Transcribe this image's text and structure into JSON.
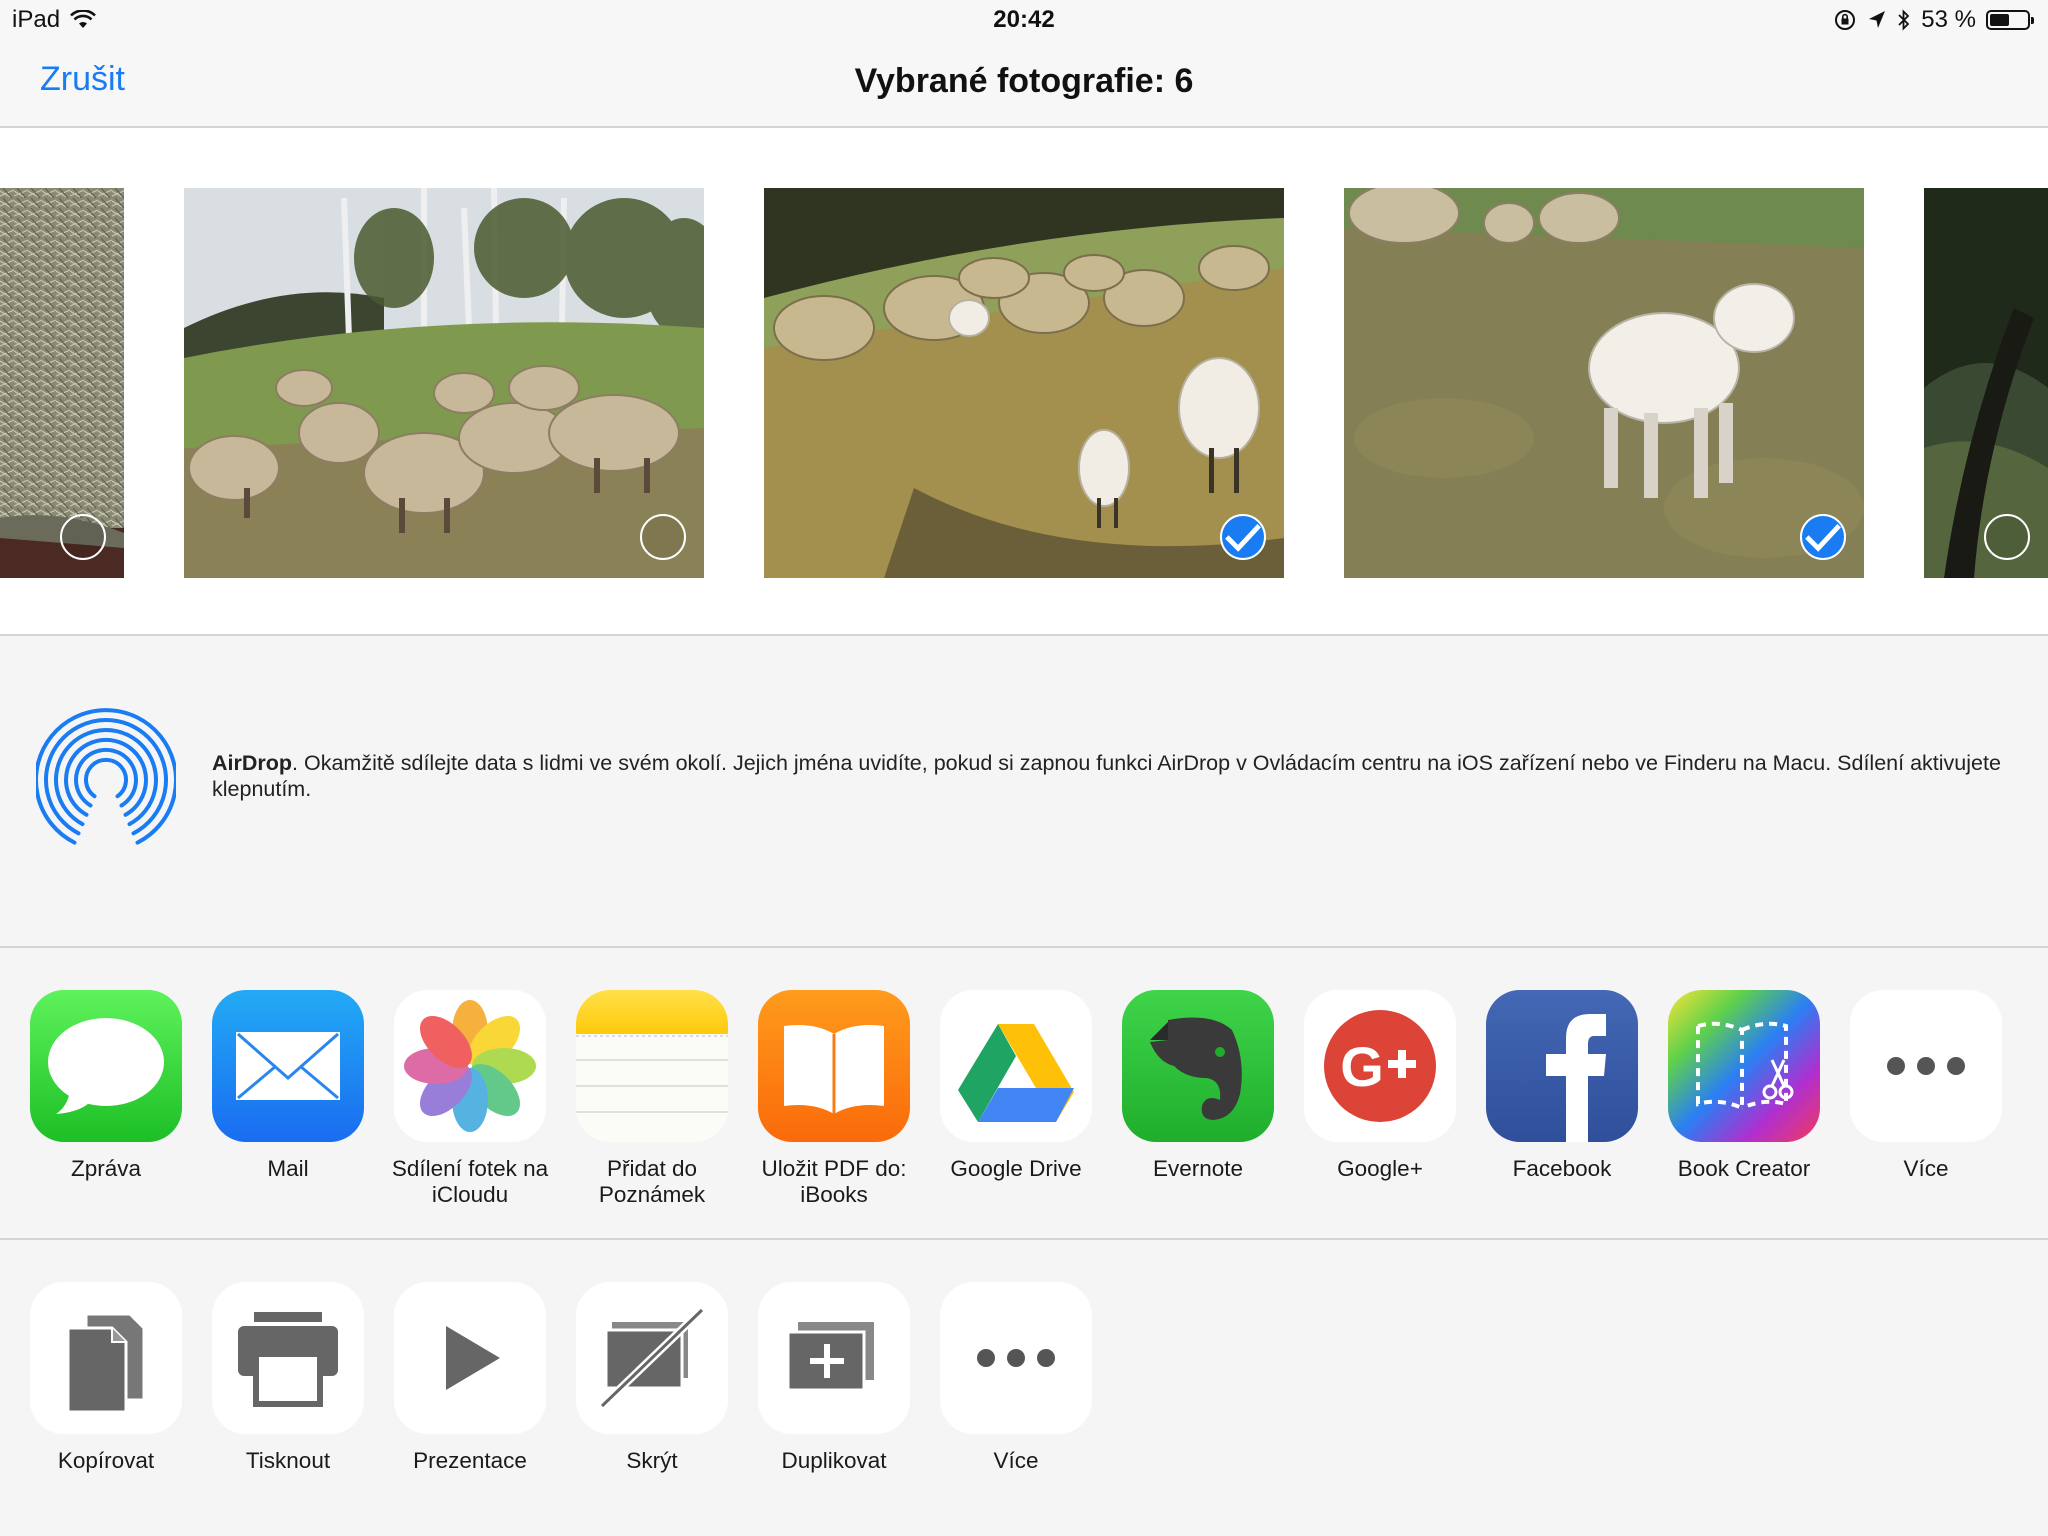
{
  "status_bar": {
    "device": "iPad",
    "time": "20:42",
    "battery_text": "53 %",
    "battery_level": 0.53,
    "icons": [
      "wifi-icon",
      "orientation-lock-icon",
      "location-icon",
      "bluetooth-icon",
      "battery-icon"
    ]
  },
  "nav": {
    "cancel_label": "Zrušit",
    "title": "Vybrané fotografie: 6"
  },
  "photos": [
    {
      "name": "hay",
      "selected": false
    },
    {
      "name": "sheep-flock-birch",
      "selected": false
    },
    {
      "name": "sheep-flock-lambs",
      "selected": true
    },
    {
      "name": "lamb-closeup",
      "selected": true
    },
    {
      "name": "tree",
      "selected": false
    }
  ],
  "airdrop": {
    "title": "AirDrop",
    "description": ". Okamžitě sdílejte data s lidmi ve svém okolí. Jejich jména uvidíte, pokud si zapnou funkci AirDrop v Ovládacím centru na iOS zařízení nebo ve Finderu na Macu. Sdílení aktivujete klepnutím."
  },
  "share_apps": [
    {
      "label": "Zpráva",
      "icon": "messages-icon"
    },
    {
      "label": "Mail",
      "icon": "mail-icon"
    },
    {
      "label": "Sdílení fotek na iCloudu",
      "icon": "photos-icon"
    },
    {
      "label": "Přidat do Poznámek",
      "icon": "notes-icon"
    },
    {
      "label": "Uložit PDF do: iBooks",
      "icon": "ibooks-icon"
    },
    {
      "label": "Google Drive",
      "icon": "google-drive-icon"
    },
    {
      "label": "Evernote",
      "icon": "evernote-icon"
    },
    {
      "label": "Google+",
      "icon": "google-plus-icon"
    },
    {
      "label": "Facebook",
      "icon": "facebook-icon"
    },
    {
      "label": "Book Creator",
      "icon": "book-creator-icon"
    },
    {
      "label": "Více",
      "icon": "more-icon"
    }
  ],
  "actions": [
    {
      "label": "Kopírovat",
      "icon": "copy-icon"
    },
    {
      "label": "Tisknout",
      "icon": "print-icon"
    },
    {
      "label": "Prezentace",
      "icon": "slideshow-icon"
    },
    {
      "label": "Skrýt",
      "icon": "hide-icon"
    },
    {
      "label": "Duplikovat",
      "icon": "duplicate-icon"
    },
    {
      "label": "Více",
      "icon": "more-icon"
    }
  ],
  "colors": {
    "accent": "#1a7cf2",
    "background": "#f5f5f6",
    "separator": "#d4d4d6"
  }
}
